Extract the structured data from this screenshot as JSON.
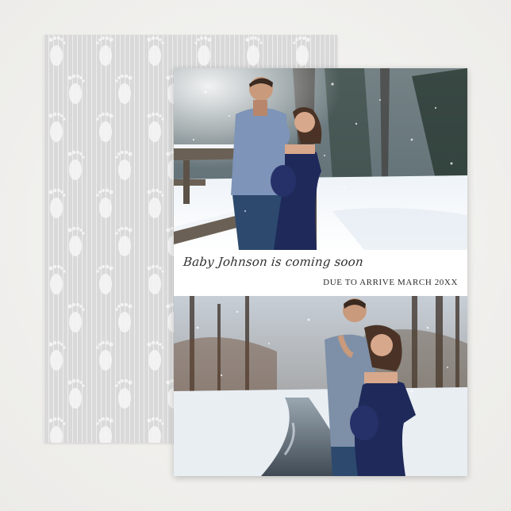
{
  "card": {
    "headline": "Baby Johnson is coming soon",
    "due_line": "DUE TO ARRIVE MARCH 20XX"
  },
  "colors": {
    "background": "#f1f1ef",
    "back_card": "#d9d9d9",
    "front_card": "#ffffff",
    "text": "#2b2b2b",
    "dress_navy": "#1f2a5a"
  },
  "icons": [
    "baby-footprint-icon"
  ]
}
